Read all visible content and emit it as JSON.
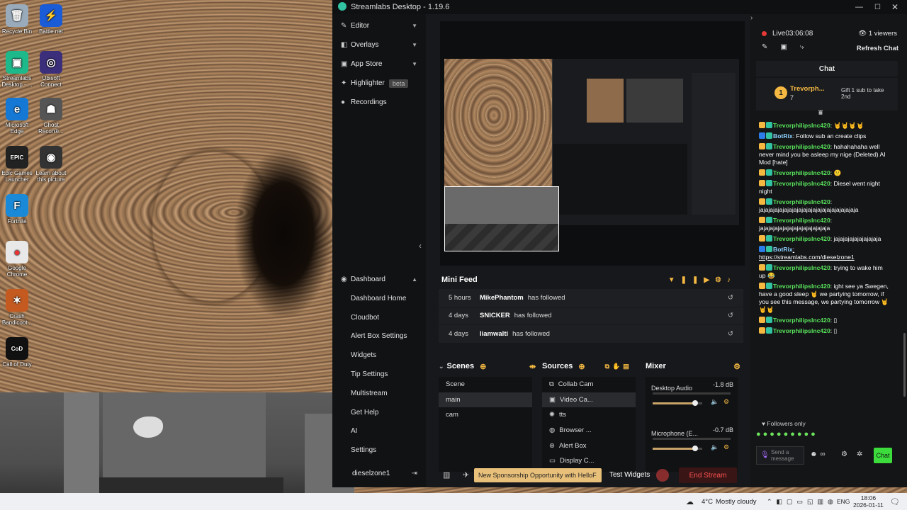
{
  "desktop_icons": [
    {
      "label": "Recycle Bin",
      "glyph": "🗑"
    },
    {
      "label": "Battle.net",
      "glyph": "⚡"
    },
    {
      "label": "Streamlabs Desktop - ...",
      "glyph": "▣"
    },
    {
      "label": "Ubisoft Connect",
      "glyph": "◎"
    },
    {
      "label": "Microsoft Edge",
      "glyph": "e"
    },
    {
      "label": "Ghost Recon®...",
      "glyph": "☗"
    },
    {
      "label": "Epic Games Launcher",
      "glyph": "EPIC"
    },
    {
      "label": "Learn about this picture",
      "glyph": "◉"
    },
    {
      "label": "Fortnite",
      "glyph": "F"
    },
    {
      "label": "Google Chrome",
      "glyph": "●"
    },
    {
      "label": "Crash Bandicoot...",
      "glyph": "✶"
    },
    {
      "label": "Call of Duty",
      "glyph": "CoD"
    }
  ],
  "app": {
    "title": "Streamlabs Desktop - 1.19.6"
  },
  "sidebar": {
    "items": [
      {
        "label": "Editor",
        "icon": "editor-icon"
      },
      {
        "label": "Overlays",
        "icon": "overlays-icon"
      },
      {
        "label": "App Store",
        "icon": "appstore-icon"
      },
      {
        "label": "Highlighter",
        "icon": "highlighter-icon",
        "badge": "beta"
      },
      {
        "label": "Recordings",
        "icon": "recordings-icon"
      }
    ],
    "dashboard": {
      "label": "Dashboard",
      "subitems": [
        "Dashboard Home",
        "Cloudbot",
        "Alert Box Settings",
        "Widgets",
        "Tip Settings",
        "Multistream",
        "Get Help",
        "AI",
        "Settings"
      ]
    },
    "user": "dieselzone1"
  },
  "minifeed": {
    "title": "Mini Feed",
    "rows": [
      {
        "time": "5 hours",
        "name": "MikePhantom",
        "action": "has followed"
      },
      {
        "time": "4 days",
        "name": "SNICKER",
        "action": "has followed"
      },
      {
        "time": "4 days",
        "name": "liamwalti",
        "action": "has followed"
      }
    ]
  },
  "scenes": {
    "title": "Scenes",
    "items": [
      "Scene",
      "main",
      "cam"
    ],
    "selected": "main"
  },
  "sources": {
    "title": "Sources",
    "items": [
      {
        "label": "Collab Cam",
        "icon": "collab-cam-icon"
      },
      {
        "label": "Video Ca...",
        "icon": "video-capture-icon"
      },
      {
        "label": "tts",
        "icon": "tts-icon"
      },
      {
        "label": "Browser ...",
        "icon": "browser-icon"
      },
      {
        "label": "Alert Box",
        "icon": "alertbox-icon"
      },
      {
        "label": "Display C...",
        "icon": "display-capture-icon"
      }
    ]
  },
  "mixer": {
    "title": "Mixer",
    "channels": [
      {
        "name": "Desktop Audio",
        "db": "-1.8 dB",
        "level": 0.85
      },
      {
        "name": "Microphone (E...",
        "db": "-0.7 dB",
        "level": 0.86
      }
    ]
  },
  "footer": {
    "sponsorship": "New Sponsorship Opportunity with HelloF",
    "test_widgets": "Test Widgets",
    "end_stream": "End Stream"
  },
  "chat": {
    "live_label": "Live",
    "live_time": "03:06:08",
    "viewers": "1 viewers",
    "refresh": "Refresh Chat",
    "title": "Chat",
    "gift": {
      "rank": "1",
      "name": "Trevorph...",
      "count": "7",
      "text": "Gift 1 sub to take 2nd"
    },
    "messages": [
      {
        "user": "TrevorphilipsInc420",
        "text": ": 🤘🤘🤘🤘",
        "kind": "user"
      },
      {
        "user": "BotRix",
        "text": ": Follow sub an create clips",
        "kind": "bot"
      },
      {
        "user": "TrevorphilipsInc420",
        "text": ": hahahahaha well never mind you be asleep my nige (Deleted) AI Mod [hate]",
        "kind": "user"
      },
      {
        "user": "TrevorphilipsInc420",
        "text": ": 🙂",
        "kind": "user"
      },
      {
        "user": "TrevorphilipsInc420",
        "text": ": Diesel went night night",
        "kind": "user"
      },
      {
        "user": "TrevorphilipsInc420",
        "text": ": jajajajajajajajajajajajajajajajajajajajaja",
        "kind": "user"
      },
      {
        "user": "TrevorphilipsInc420",
        "text": ": jajajajajajajajajajajajajajaja",
        "kind": "user"
      },
      {
        "user": "TrevorphilipsInc420",
        "text": ": jajajajajajajajajaja",
        "kind": "user"
      },
      {
        "user": "BotRix",
        "text": ": https://streamlabs.com/dieselzone1",
        "kind": "bot"
      },
      {
        "user": "TrevorphilipsInc420",
        "text": ": trying to wake him up 😂",
        "kind": "user"
      },
      {
        "user": "TrevorphilipsInc420",
        "text": ": ight see ya Swegen, have a good sleep 🤘 we partying tomorrow, if you see this message, we partying tomorrow 🤘🤘🤘",
        "kind": "user"
      },
      {
        "user": "TrevorphilipsInc420",
        "text": ": ▯",
        "kind": "user"
      },
      {
        "user": "TrevorphilipsInc420",
        "text": ": ▯",
        "kind": "user"
      }
    ],
    "followers_only": "Followers only",
    "placeholder": "Send a message",
    "send": "Chat"
  },
  "taskbar": {
    "weather_temp": "4°C",
    "weather_text": "Mostly cloudy",
    "lang": "ENG",
    "time": "18:06",
    "date": "2026-01-11"
  }
}
